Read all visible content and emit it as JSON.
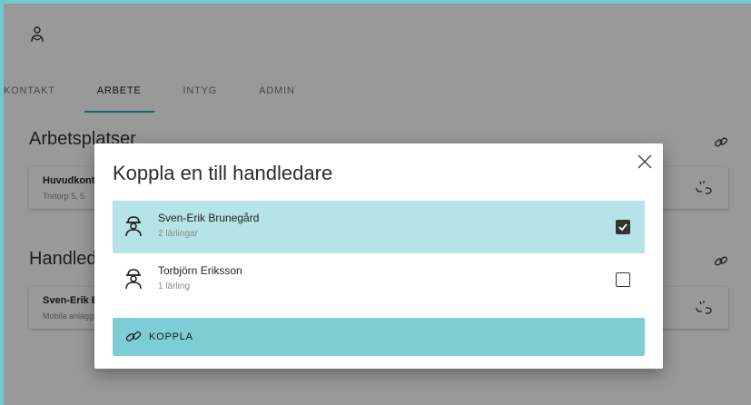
{
  "header": {
    "app_icon": "people-icon"
  },
  "tabs": [
    {
      "label": "KONTAKT",
      "active": false
    },
    {
      "label": "ARBETE",
      "active": true
    },
    {
      "label": "INTYG",
      "active": false
    },
    {
      "label": "ADMIN",
      "active": false
    }
  ],
  "sections": {
    "arbetsplatser": {
      "title": "Arbetsplatser",
      "card": {
        "title": "Huvudkontoret",
        "subtitle": "Tretorp 5, 5"
      }
    },
    "handledare": {
      "title": "Handledare",
      "card": {
        "title": "Sven-Erik Brunegård",
        "subtitle": "Mobila anläggningar"
      }
    }
  },
  "modal": {
    "title": "Koppla en till handledare",
    "rows": [
      {
        "name": "Sven-Erik Brunegård",
        "sub": "2 lärlingar",
        "checked": true
      },
      {
        "name": "Torbjörn Eriksson",
        "sub": "1 lärling",
        "checked": false
      }
    ],
    "button_label": "KOPPLA"
  },
  "colors": {
    "accent": "#6fcacf",
    "selected_row": "#b5e3e7",
    "button": "#7ccdd4"
  }
}
